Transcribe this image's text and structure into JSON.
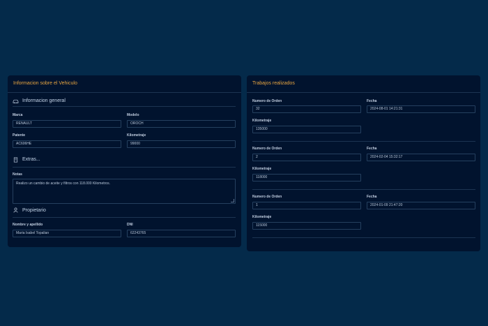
{
  "vehicle": {
    "title": "Informacion sobre el Vehiculo",
    "general": {
      "title": "Informacion general",
      "icon": "car-icon",
      "marca_label": "Marca",
      "marca_value": "RENAULT",
      "modelo_label": "Modelo",
      "modelo_value": "OROCH",
      "patente_label": "Patente",
      "patente_value": "AC606HE",
      "km_label": "Kilometraje",
      "km_value": "99000"
    },
    "extras": {
      "title": "Extras...",
      "icon": "document-icon",
      "notas_label": "Notas",
      "notas_value": "Realizo un cambio de aceite y filtros con 118.000 Kilometros."
    },
    "owner": {
      "title": "Propietario",
      "icon": "person-icon",
      "name_label": "Nombre y apellido",
      "name_value": "Maria Isabel Topalian",
      "dni_label": "DNI",
      "dni_value": "62243765"
    }
  },
  "works": {
    "title": "Trabajos realizados",
    "order_label": "Numero de Orden",
    "date_label": "Fecha",
    "km_label": "Kilometraje",
    "items": [
      {
        "order": "32",
        "date": "2024-08-01 14:21:31",
        "km": "135000"
      },
      {
        "order": "2",
        "date": "2024-02-04 15:32:17",
        "km": "118000"
      },
      {
        "order": "1",
        "date": "2024-01-09 21:47:20",
        "km": "115000"
      }
    ]
  }
}
